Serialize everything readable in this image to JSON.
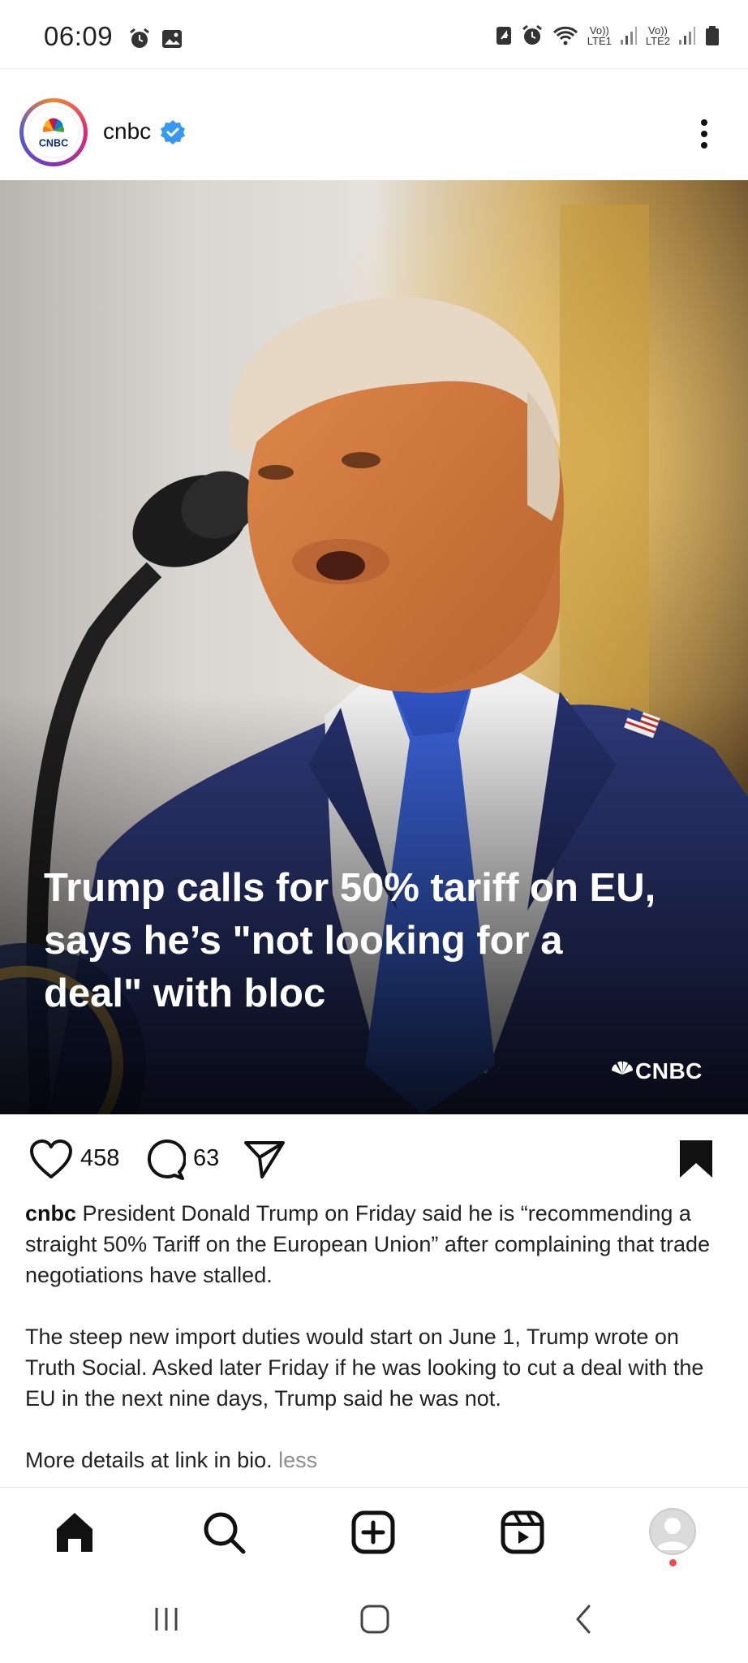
{
  "status_bar": {
    "time": "06:09",
    "net1_top": "Vo))",
    "net1_bottom": "LTE1",
    "net2_top": "Vo))",
    "net2_bottom": "LTE2"
  },
  "post": {
    "username": "cnbc",
    "avatar_text": "CNBC",
    "headline": "Trump calls for 50% tariff on EU, says he’s \"not looking for a deal\" with bloc",
    "watermark": "CNBC",
    "likes": "458",
    "comments": "63",
    "caption": {
      "user": "cnbc",
      "p1": "President Donald Trump on Friday said he is “recommending a straight 50% Tariff on the European Union” after complaining that trade negotiations have stalled.",
      "p2": "The steep new import duties would start on June 1, Trump wrote on Truth Social. Asked later Friday if he was looking to cut a deal with the EU in the next nine days, Trump said he was not.",
      "p3": "More details at link in bio.",
      "less": "less"
    }
  },
  "colors": {
    "verified": "#3897f0",
    "notification_dot": "#ed4956",
    "suit": "#2e3a7a",
    "tie": "#3a62d6"
  }
}
